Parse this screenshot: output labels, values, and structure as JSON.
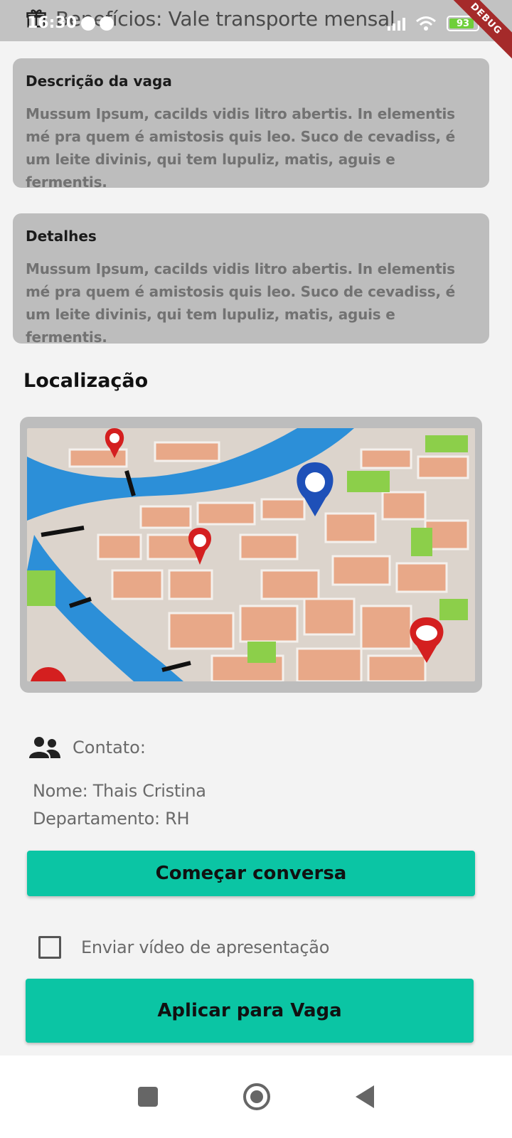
{
  "status_bar": {
    "time": "16:30",
    "battery": "93",
    "debug_label": "DEBUG"
  },
  "header": {
    "benefits_text": "Benefícios: Vale transporte mensal",
    "benefits_icon": "gift-icon"
  },
  "job_description": {
    "title": "Descrição da vaga",
    "body": "Mussum Ipsum, cacilds vidis litro abertis. In elementis mé pra quem é amistosis quis leo. Suco de cevadiss, é um leite divinis, qui tem lupuliz, matis, aguis e fermentis."
  },
  "details": {
    "title": "Detalhes",
    "body": "Mussum Ipsum, cacilds vidis litro abertis. In elementis mé pra quem é amistosis quis leo. Suco de cevadiss, é um leite divinis, qui tem lupuliz, matis, aguis e fermentis."
  },
  "location": {
    "title": "Localização"
  },
  "contact": {
    "label": "Contato:",
    "name": "Nome: Thais Cristina",
    "department": "Departamento: RH",
    "icon": "people-icon"
  },
  "actions": {
    "chat_label": "Começar conversa",
    "video_checkbox_label": "Enviar vídeo de apresentação",
    "video_checked": false,
    "apply_label": "Aplicar para Vaga"
  },
  "colors": {
    "accent": "#0bc5a4",
    "card_bg": "#bdbdbd",
    "page_bg": "#f3f3f3"
  }
}
